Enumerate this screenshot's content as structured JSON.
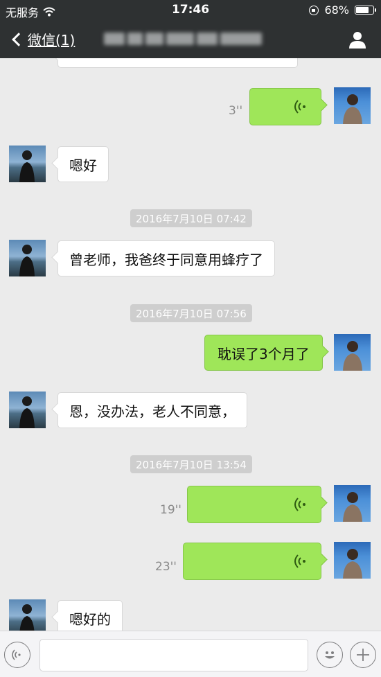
{
  "status_bar": {
    "carrier": "无服务",
    "time": "17:46",
    "battery_level": 0.68,
    "battery_text": "68%"
  },
  "nav": {
    "back_label": "微信(1)",
    "title_blurred": true
  },
  "messages": [
    {
      "type": "text",
      "side": "in",
      "text": ""
    },
    {
      "type": "voice",
      "side": "out",
      "duration": "3''"
    },
    {
      "type": "text",
      "side": "in",
      "text": "嗯好"
    },
    {
      "type": "timestamp",
      "text": "2016年7月10日 07:42"
    },
    {
      "type": "text",
      "side": "in",
      "text": "曾老师，我爸终于同意用蜂疗了"
    },
    {
      "type": "timestamp",
      "text": "2016年7月10日 07:56"
    },
    {
      "type": "text",
      "side": "out",
      "text": "耽误了3个月了"
    },
    {
      "type": "text",
      "side": "in",
      "text": "恩，没办法，老人不同意，"
    },
    {
      "type": "timestamp",
      "text": "2016年7月10日 13:54"
    },
    {
      "type": "voice",
      "side": "out",
      "duration": "19''"
    },
    {
      "type": "voice",
      "side": "out",
      "duration": "23''"
    },
    {
      "type": "text",
      "side": "in",
      "text": "嗯好的"
    }
  ],
  "input": {
    "placeholder": "",
    "value": ""
  },
  "icons": {
    "voice_toggle": "voice-mode-icon",
    "emoji": "emoji-icon",
    "more": "plus-icon",
    "profile": "person-icon",
    "back": "chevron-left-icon"
  },
  "colors": {
    "nav_bg": "#2e3132",
    "chat_bg": "#ebebeb",
    "outgoing_bubble": "#9fe659",
    "incoming_bubble": "#ffffff",
    "timestamp_bg": "#cecece"
  }
}
